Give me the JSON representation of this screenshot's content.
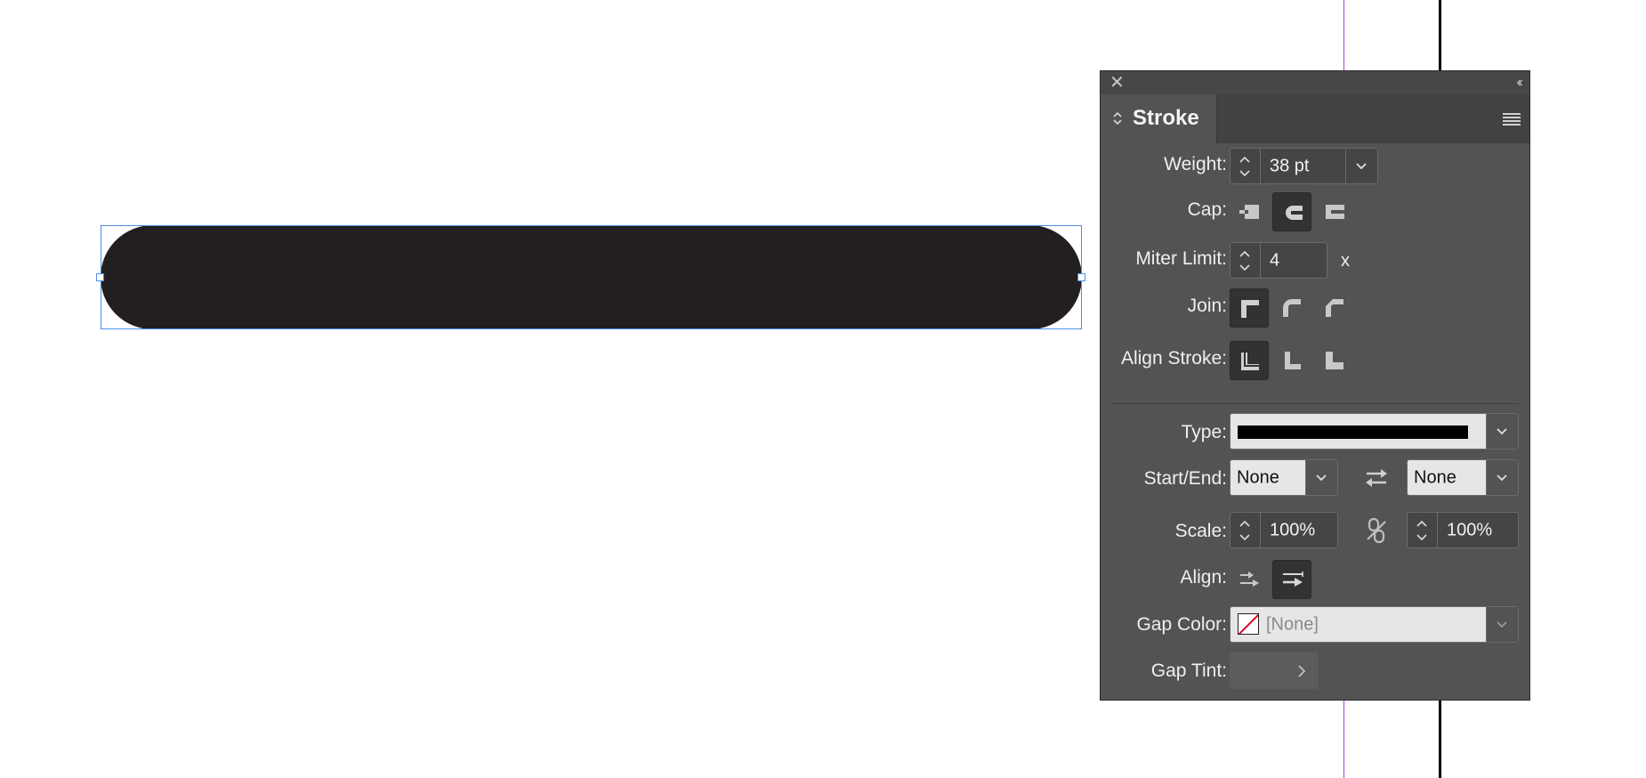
{
  "panel": {
    "tab_label": "Stroke",
    "weight": {
      "label": "Weight:",
      "value": "38 pt"
    },
    "cap": {
      "label": "Cap:",
      "selected": "round-cap"
    },
    "miter": {
      "label": "Miter Limit:",
      "value": "4",
      "suffix": "x"
    },
    "join": {
      "label": "Join:",
      "selected": "miter-join"
    },
    "align_stroke": {
      "label": "Align Stroke:",
      "selected": "center"
    },
    "type": {
      "label": "Type:"
    },
    "start_end": {
      "label": "Start/End:",
      "start": "None",
      "end": "None"
    },
    "scale": {
      "label": "Scale:",
      "start": "100%",
      "end": "100%"
    },
    "align": {
      "label": "Align:",
      "selected": "extend-beyond-path"
    },
    "gap_color": {
      "label": "Gap Color:",
      "value": "[None]"
    },
    "gap_tint": {
      "label": "Gap Tint:"
    }
  },
  "colors": {
    "shape_fill": "#231f20",
    "selection": "#4a90e2",
    "guide": "#b23ad1",
    "panel_bg": "#535353"
  }
}
